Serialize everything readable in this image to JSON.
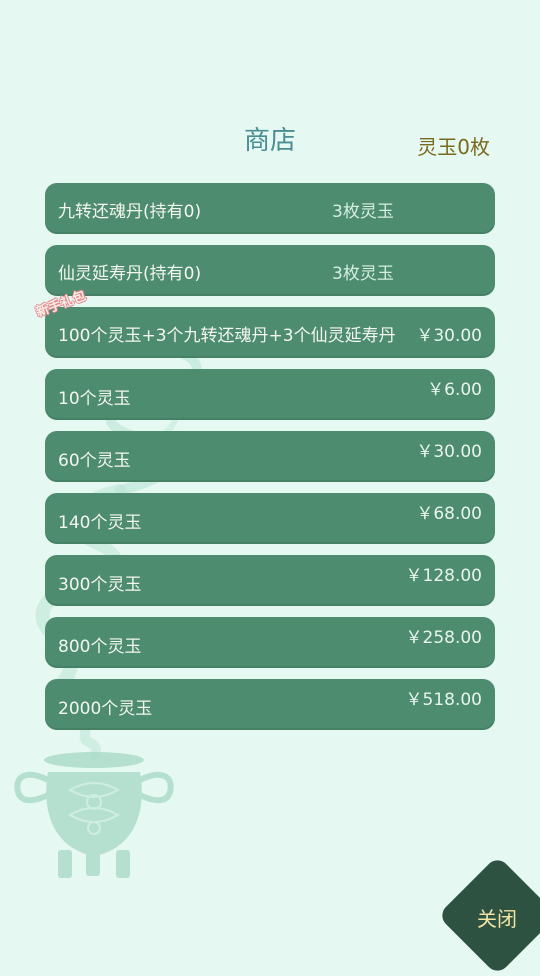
{
  "shop": {
    "title": "商店",
    "currency": "灵玉0枚",
    "badge": "新手礼包",
    "close_label": "关闭"
  },
  "items": [
    {
      "name": "九转还魂丹(持有0)",
      "price": "3枚灵玉"
    },
    {
      "name": "仙灵延寿丹(持有0)",
      "price": "3枚灵玉"
    },
    {
      "name": "100个灵玉+3个九转还魂丹+3个仙灵延寿丹",
      "price": "￥30.00"
    },
    {
      "name": "10个灵玉",
      "price": "￥6.00"
    },
    {
      "name": "60个灵玉",
      "price": "￥30.00"
    },
    {
      "name": "140个灵玉",
      "price": "￥68.00"
    },
    {
      "name": "300个灵玉",
      "price": "￥128.00"
    },
    {
      "name": "800个灵玉",
      "price": "￥258.00"
    },
    {
      "name": "2000个灵玉",
      "price": "￥518.00"
    }
  ],
  "colors": {
    "background": "#e5f8f1",
    "item": "#4d8c6e",
    "close_button": "#2e5241",
    "title": "#4a8d93",
    "currency": "#7a6a1e"
  },
  "decoration": "incense-burner-with-smoke"
}
